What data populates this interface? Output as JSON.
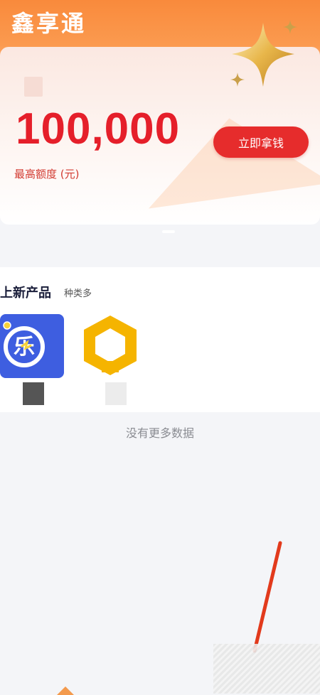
{
  "app": {
    "title": "鑫享通"
  },
  "credit_card": {
    "amount": "100,000",
    "label": "最高额度 (元)",
    "button_label": "立即拿钱"
  },
  "products": {
    "title": "上新产品",
    "subtitle": "种类多",
    "items": [
      {
        "name": "乐",
        "icon": "le-lightning-icon"
      },
      {
        "name": "",
        "icon": "hexagon-icon"
      }
    ]
  },
  "footer": {
    "empty_text": "没有更多数据"
  },
  "colors": {
    "accent": "#e62c2c",
    "header_orange": "#f98a3c",
    "amount_red": "#e51f2a",
    "product_blue": "#3e5ee0",
    "product_yellow": "#f5b400"
  }
}
